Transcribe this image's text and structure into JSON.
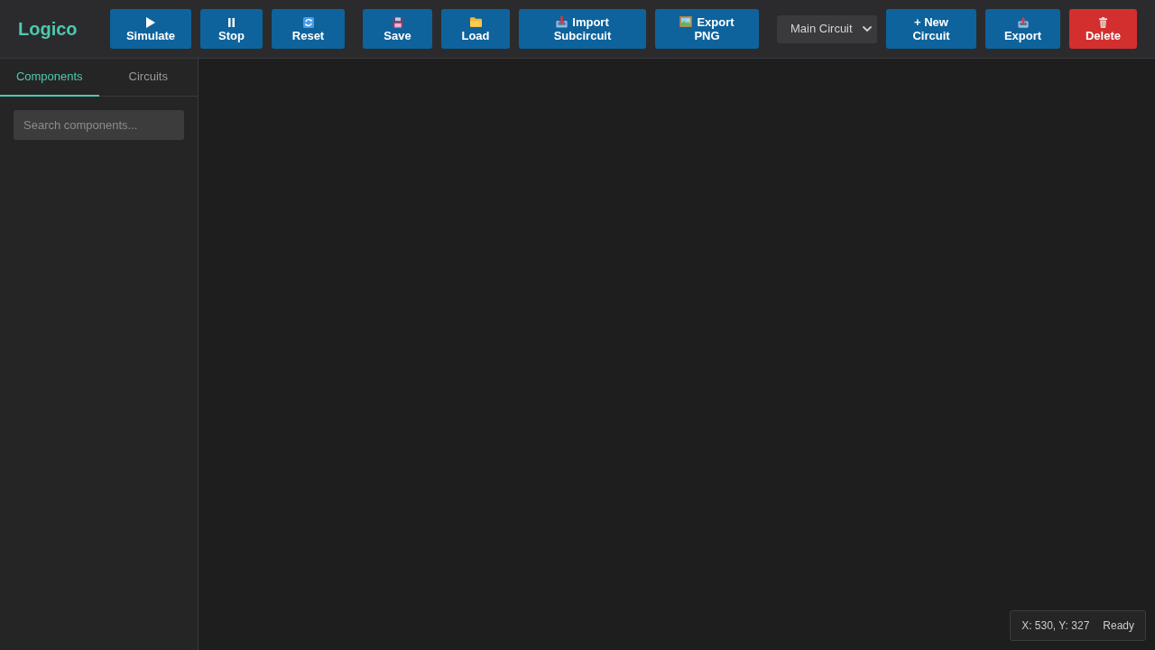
{
  "header": {
    "logo": "Logico",
    "simulation_buttons": [
      {
        "label": "Simulate"
      },
      {
        "label": "Stop"
      },
      {
        "label": "Reset"
      }
    ],
    "file_buttons": [
      {
        "label": "Save"
      },
      {
        "label": "Load"
      },
      {
        "label": "Import Subcircuit"
      },
      {
        "label": "Export PNG"
      }
    ],
    "circuit_select": {
      "value": "Main Circuit"
    },
    "circuit_buttons": [
      {
        "label": "+ New Circuit",
        "kind": "primary"
      },
      {
        "label": "Export",
        "kind": "primary"
      },
      {
        "label": "Delete",
        "kind": "danger"
      }
    ]
  },
  "sidebar": {
    "tabs": [
      {
        "label": "Components",
        "selected": true
      },
      {
        "label": "Circuits",
        "selected": false
      }
    ],
    "search": {
      "placeholder": "Search components..."
    }
  },
  "status": {
    "coordinates": "X: 530, Y: 327",
    "state": "Ready"
  }
}
